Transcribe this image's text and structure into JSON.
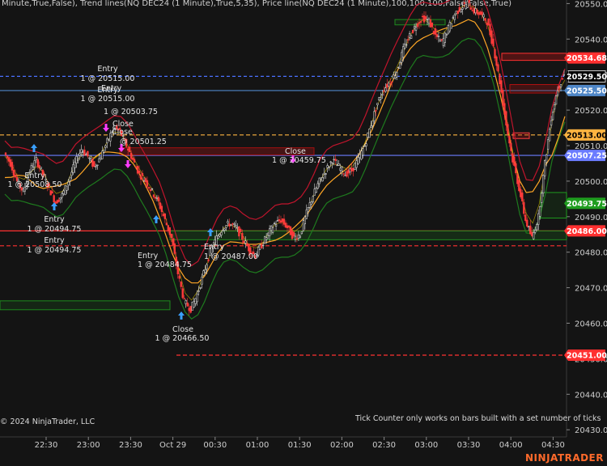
{
  "header": {
    "indicator_text": "Minute,True,False), Trend lines(NQ DEC24 (1 Minute),True,5,35), Price line(NQ DEC24 (1 Minute),100,100,100,False,False,True)"
  },
  "footer": {
    "copyright": "© 2024 NinjaTrader, LLC",
    "note": "Tick Counter only works on bars built with a set number of ticks",
    "brand": "NINJATRADER"
  },
  "colors": {
    "background": "#141414",
    "up_bar": "#e8e8e8",
    "down_bar": "#ff3b3b",
    "ma_fast": "#ffa726",
    "band_upper": "#c0142c",
    "band_lower": "#1e7a1e",
    "level_blue": "#6b7cff",
    "level_red": "#ff3030",
    "level_orange": "#ffb340",
    "buy_arrow": "#3aa0ff",
    "sell_arrow": "#ff3cff"
  },
  "chart_data": {
    "type": "candlestick",
    "instrument": "NQ DEC24",
    "interval": "1 Minute",
    "x_ticks": [
      "22:30",
      "23:00",
      "23:30",
      "Oct 29",
      "00:30",
      "01:00",
      "01:30",
      "02:00",
      "02:30",
      "03:00",
      "03:30",
      "04:00",
      "04:30"
    ],
    "y_ticks": [
      20550,
      20540,
      20530,
      20520,
      20510,
      20500,
      20490,
      20480,
      20470,
      20460,
      20450,
      20440,
      20430
    ],
    "ylim": [
      20428,
      20551
    ],
    "price_tags": [
      {
        "value": "20534.68",
        "price": 20534.68,
        "bg": "#ff3030",
        "fg": "#ffffff"
      },
      {
        "value": "20529.50",
        "price": 20529.5,
        "bg": "#000000",
        "fg": "#ffffff"
      },
      {
        "value": "20525.50",
        "price": 20525.5,
        "bg": "#4f86c6",
        "fg": "#ffffff"
      },
      {
        "value": "20513.00",
        "price": 20513.0,
        "bg": "#ffb340",
        "fg": "#000000"
      },
      {
        "value": "20507.25",
        "price": 20507.25,
        "bg": "#6b7cff",
        "fg": "#ffffff"
      },
      {
        "value": "20493.75",
        "price": 20493.75,
        "bg": "#1f9d1f",
        "fg": "#ffffff"
      },
      {
        "value": "20486.00",
        "price": 20486.0,
        "bg": "#ff3030",
        "fg": "#ffffff"
      },
      {
        "value": "20451.00",
        "price": 20451.0,
        "bg": "#ff3030",
        "fg": "#ffffff"
      }
    ],
    "price_series": [
      20508,
      20505,
      20500,
      20497,
      20503,
      20506,
      20502,
      20498,
      20494,
      20496,
      20500,
      20505,
      20509,
      20507,
      20504,
      20507,
      20511,
      20515,
      20514,
      20510,
      20506,
      20502,
      20500,
      20497,
      20494,
      20489,
      20484,
      20474,
      20466,
      20464,
      20468,
      20474,
      20480,
      20484,
      20487,
      20488,
      20487,
      20484,
      20481,
      20479,
      20482,
      20485,
      20488,
      20489,
      20487,
      20484,
      20485,
      20491,
      20496,
      20500,
      20503,
      20506,
      20504,
      20502,
      20503,
      20506,
      20510,
      20516,
      20522,
      20526,
      20528,
      20531,
      20537,
      20541,
      20544,
      20546,
      20545,
      20541,
      20539,
      20543,
      20547,
      20549,
      20550,
      20548,
      20547,
      20545,
      20538,
      20528,
      20516,
      20506,
      20498,
      20489,
      20484,
      20490,
      20505,
      20518,
      20526,
      20530
    ],
    "annotations": [
      {
        "text": "Entry"
      },
      {
        "text": "1 @ 20515.00"
      },
      {
        "text": "Entry"
      },
      {
        "text": "1 @ 20515.00"
      },
      {
        "text": "Entry"
      },
      {
        "text": "1 @ 20503.75"
      },
      {
        "text": "Close"
      },
      {
        "text": "Close"
      },
      {
        "text": "@ 20501.25"
      },
      {
        "text": "Entry"
      },
      {
        "text": "1 @ 20508.50"
      },
      {
        "text": "Entry"
      },
      {
        "text": "1 @ 20494.75"
      },
      {
        "text": "Entry"
      },
      {
        "text": "1 @ 20494.75"
      },
      {
        "text": "Entry"
      },
      {
        "text": "1 @ 20484.75"
      },
      {
        "text": "Close"
      },
      {
        "text": "1 @ 20466.50"
      },
      {
        "text": "Entry"
      },
      {
        "text": "1 @ 20487.00"
      },
      {
        "text": "Close"
      },
      {
        "text": "1 @ 20459.75"
      }
    ]
  }
}
